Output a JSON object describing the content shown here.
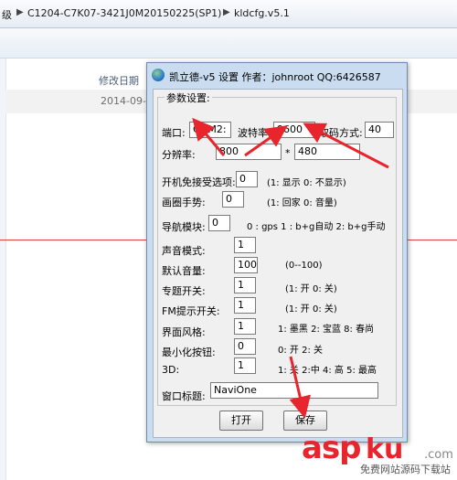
{
  "explorer": {
    "breadcrumb": [
      "级",
      "C1204-C7K07-3421J0M20150225(SP1)",
      "kldcfg.v5.1"
    ],
    "column_header_date": "修改日期",
    "row_date": "2014-09-19"
  },
  "dialog": {
    "title": "凯立德-v5 设置  作者：johnroot  QQ:6426587",
    "group_title": "参数设置:",
    "port_label": "端口:",
    "port_value": "COM2:",
    "baud_label": "波特率:",
    "baud_value": "9600",
    "decode_label": "取码方式:",
    "decode_value": "40",
    "resolution_label": "分辨率:",
    "res_width": "800",
    "res_sep": "*",
    "res_height": "480",
    "rows": [
      {
        "label": "开机免接受选项:",
        "value": "0",
        "hint": "(1: 显示 0: 不显示)"
      },
      {
        "label": "画圈手势:",
        "value": "0",
        "hint": "(1: 回家 0: 音量)"
      },
      {
        "label": "导航模块:",
        "value": "0",
        "hint": "0 : gps 1 : b+g自动  2: b+g手动"
      },
      {
        "label": "声音模式:",
        "value": "1",
        "hint": ""
      },
      {
        "label": "默认音量:",
        "value": "100",
        "hint": "(0--100)"
      },
      {
        "label": "专题开关:",
        "value": "1",
        "hint": "(1: 开 0: 关)"
      },
      {
        "label": "FM提示开关:",
        "value": "1",
        "hint": "(1: 开 0: 关)"
      },
      {
        "label": "界面风格:",
        "value": "1",
        "hint": "1: 墨黑  2: 宝蓝  8: 春尚"
      },
      {
        "label": "最小化按钮:",
        "value": "0",
        "hint": "0: 开 2: 关"
      },
      {
        "label": "3D:",
        "value": "1",
        "hint": "1: 关 2:中 4: 高 5: 最高"
      }
    ],
    "window_title_label": "窗口标题:",
    "window_title_value": "NaviOne",
    "open_button": "打开",
    "save_button": "保存"
  },
  "watermark": {
    "text_asp": "asp",
    "text_ku": "ku",
    "text_com": ".com",
    "sub": "免费网站源码下载站"
  }
}
